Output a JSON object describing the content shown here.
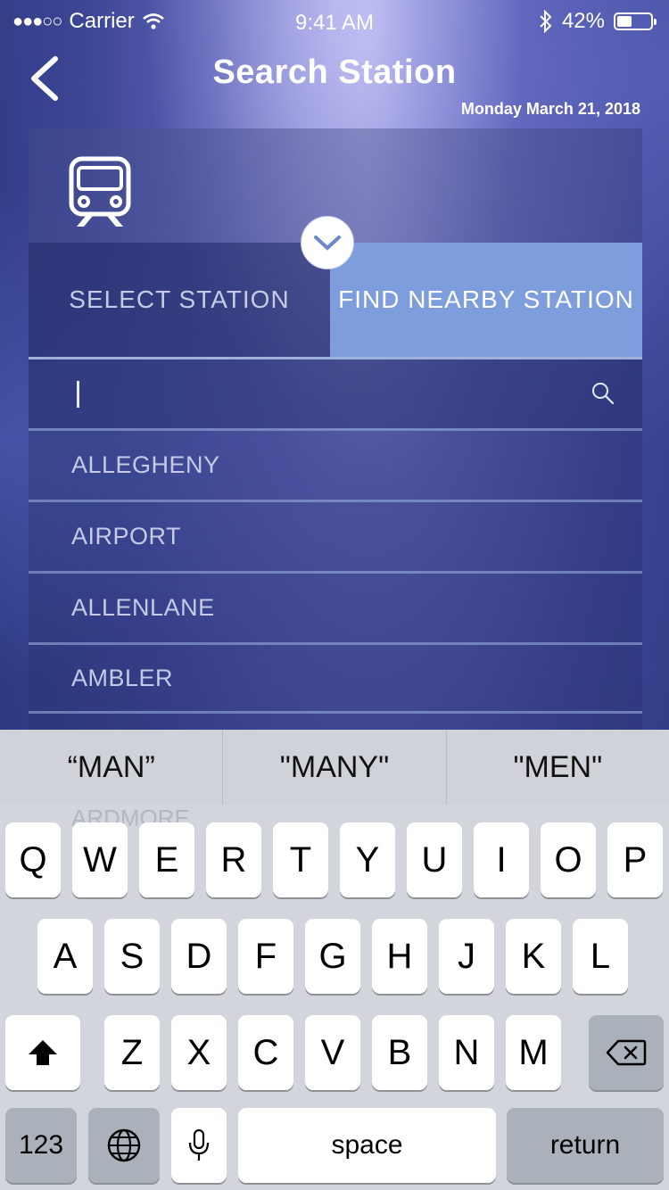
{
  "status_bar": {
    "carrier": "Carrier",
    "time": "9:41 AM",
    "battery": "42%"
  },
  "nav": {
    "title": "Search Station",
    "date": "Monday March 21, 2018"
  },
  "tabs": {
    "select": "SELECT STATION",
    "nearby": "FIND NEARBY STATION"
  },
  "search": {
    "value": ""
  },
  "stations": [
    "ALLEGHENY",
    "AIRPORT",
    "ALLENLANE",
    "AMBLER"
  ],
  "background_hint": "ARDMORE",
  "keyboard": {
    "suggestions": [
      "“MAN”",
      "\"MANY\"",
      "\"MEN\""
    ],
    "row1": [
      "Q",
      "W",
      "E",
      "R",
      "T",
      "Y",
      "U",
      "I",
      "O",
      "P"
    ],
    "row2": [
      "A",
      "S",
      "D",
      "F",
      "G",
      "H",
      "J",
      "K",
      "L"
    ],
    "row3": [
      "Z",
      "X",
      "C",
      "V",
      "B",
      "N",
      "M"
    ],
    "numbers": "123",
    "space": "space",
    "return": "return"
  },
  "colors": {
    "tab_active": "#7e9ddc",
    "keyboard_bg": "#d2d5db"
  },
  "icons": [
    "back-chevron-icon",
    "train-icon",
    "chevron-down-icon",
    "search-icon",
    "shift-icon",
    "backspace-icon",
    "globe-icon",
    "microphone-icon",
    "wifi-icon",
    "bluetooth-icon"
  ]
}
